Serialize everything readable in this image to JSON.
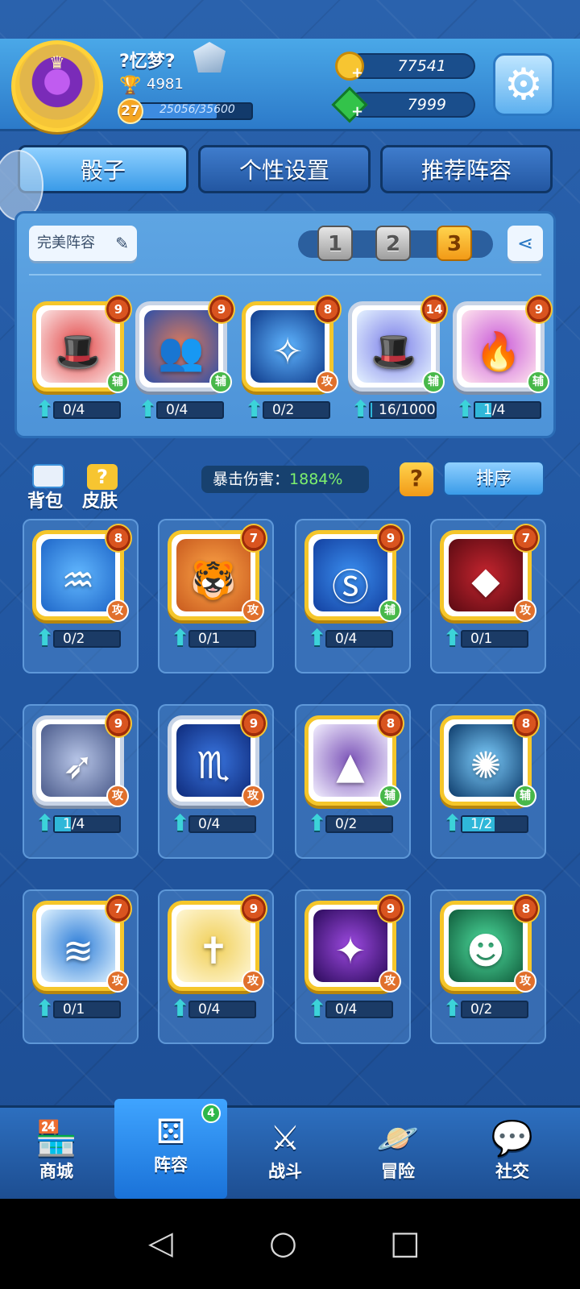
{
  "player": {
    "name": "?忆梦?",
    "trophies": "4981",
    "level": "27",
    "xp": "25056/35600",
    "xp_fraction": 0.7038
  },
  "currency": {
    "gold": "77541",
    "gems": "7999"
  },
  "tabs": [
    {
      "label": "骰子"
    },
    {
      "label": "个性设置"
    },
    {
      "label": "推荐阵容"
    }
  ],
  "deck": {
    "name": "完美阵容",
    "slots": [
      "1",
      "2",
      "3"
    ],
    "active_slot": "3"
  },
  "deck_cards": [
    {
      "icon": "red-hat",
      "level": "9",
      "role": "辅",
      "progress": "0/4",
      "frame": "gold",
      "fraction": 0
    },
    {
      "icon": "twin-figures",
      "level": "9",
      "role": "辅",
      "progress": "0/4",
      "frame": "silver",
      "fraction": 0
    },
    {
      "icon": "light-figure",
      "level": "8",
      "role": "攻",
      "progress": "0/2",
      "frame": "gold",
      "fraction": 0
    },
    {
      "icon": "magic-hat",
      "level": "14",
      "role": "辅",
      "progress": "16/1000",
      "frame": "silver",
      "fraction": 0.016
    },
    {
      "icon": "fire-altar",
      "level": "9",
      "role": "辅",
      "progress": "1/4",
      "frame": "silver",
      "fraction": 0.25
    }
  ],
  "labels": {
    "bag": "背包",
    "skin": "皮肤",
    "crit_label": "暴击伤害：",
    "crit_value": "1884%",
    "help": "?",
    "sort": "排序"
  },
  "collection": [
    {
      "icon": "water-jug",
      "level": "8",
      "role": "攻",
      "progress": "0/2",
      "frame": "gold",
      "fraction": 0
    },
    {
      "icon": "tiger",
      "level": "7",
      "role": "攻",
      "progress": "0/1",
      "frame": "gold",
      "fraction": 0
    },
    {
      "icon": "s-coin",
      "level": "9",
      "role": "辅",
      "progress": "0/4",
      "frame": "gold",
      "fraction": 0
    },
    {
      "icon": "vampire",
      "level": "7",
      "role": "攻",
      "progress": "0/1",
      "frame": "gold",
      "fraction": 0
    },
    {
      "icon": "archer",
      "level": "9",
      "role": "攻",
      "progress": "1/4",
      "frame": "silver",
      "fraction": 0.25
    },
    {
      "icon": "scorpion",
      "level": "9",
      "role": "攻",
      "progress": "0/4",
      "frame": "silver",
      "fraction": 0
    },
    {
      "icon": "witch-hat",
      "level": "8",
      "role": "辅",
      "progress": "0/2",
      "frame": "gold",
      "fraction": 0
    },
    {
      "icon": "dandelion",
      "level": "8",
      "role": "辅",
      "progress": "1/2",
      "frame": "gold",
      "fraction": 0.5
    },
    {
      "icon": "dragon",
      "level": "7",
      "role": "攻",
      "progress": "0/1",
      "frame": "gold",
      "fraction": 0
    },
    {
      "icon": "holy-cross",
      "level": "9",
      "role": "攻",
      "progress": "0/4",
      "frame": "gold",
      "fraction": 0
    },
    {
      "icon": "purple-beam",
      "level": "9",
      "role": "攻",
      "progress": "0/4",
      "frame": "gold",
      "fraction": 0
    },
    {
      "icon": "ghost",
      "level": "8",
      "role": "攻",
      "progress": "0/2",
      "frame": "gold",
      "fraction": 0
    }
  ],
  "nav": [
    {
      "label": "商城",
      "icon": "shop-icon"
    },
    {
      "label": "阵容",
      "icon": "dice-icon",
      "badge": "4"
    },
    {
      "label": "战斗",
      "icon": "swords-icon"
    },
    {
      "label": "冒险",
      "icon": "planet-icon"
    },
    {
      "label": "社交",
      "icon": "chat-icon"
    }
  ],
  "colors": {
    "gold_frame": "#f5c62a",
    "attack": "#e0702c",
    "support": "#48b84a",
    "crit": "#7df06e"
  }
}
